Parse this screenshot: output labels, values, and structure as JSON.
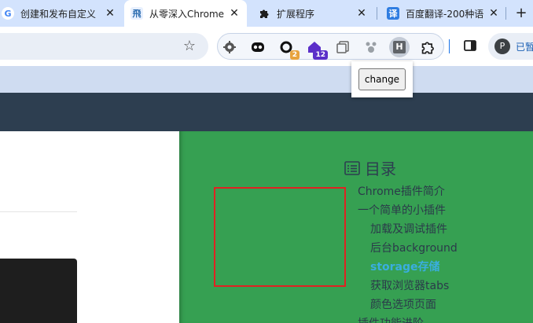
{
  "tabs": [
    {
      "title": "创建和发布自定义",
      "favicon": "G",
      "active": false
    },
    {
      "title": "从零深入Chrome",
      "favicon": "飛",
      "active": true
    },
    {
      "title": "扩展程序",
      "favicon": "puzzle",
      "active": false
    },
    {
      "title": "百度翻译-200种语",
      "favicon": "译",
      "active": false
    }
  ],
  "close_glyph": "✕",
  "new_tab_glyph": "+",
  "extensions": [
    {
      "name": "gear-extension-icon"
    },
    {
      "name": "mask-extension-icon"
    },
    {
      "name": "rotate-extension-icon",
      "badge": "2",
      "badge_color": "#e8a33d"
    },
    {
      "name": "house-extension-icon",
      "badge": "12",
      "badge_color": "#5b2fc9"
    },
    {
      "name": "copy-extension-icon"
    },
    {
      "name": "paw-extension-icon"
    },
    {
      "name": "h-extension-icon",
      "letter": "H"
    },
    {
      "name": "puzzle-extension-icon"
    }
  ],
  "profile": {
    "initial": "P",
    "label": "已暂"
  },
  "popup": {
    "button_label": "change"
  },
  "toc": {
    "title": "目录",
    "items": [
      {
        "label": "Chrome插件简介",
        "level": 1,
        "active": false
      },
      {
        "label": "一个简单的小插件",
        "level": 1,
        "active": false
      },
      {
        "label": "加载及调试插件",
        "level": 2,
        "active": false
      },
      {
        "label": "后台background",
        "level": 2,
        "active": false
      },
      {
        "label": "storage存储",
        "level": 2,
        "active": true
      },
      {
        "label": "获取浏览器tabs",
        "level": 2,
        "active": false
      },
      {
        "label": "颜色选项页面",
        "level": 2,
        "active": false
      },
      {
        "label": "插件功能进阶",
        "level": 1,
        "active": false
      }
    ]
  },
  "colors": {
    "page_background": "#36a052",
    "header": "#2d3e50",
    "highlight_border": "#e02222",
    "active_toc": "#3aaee0"
  }
}
